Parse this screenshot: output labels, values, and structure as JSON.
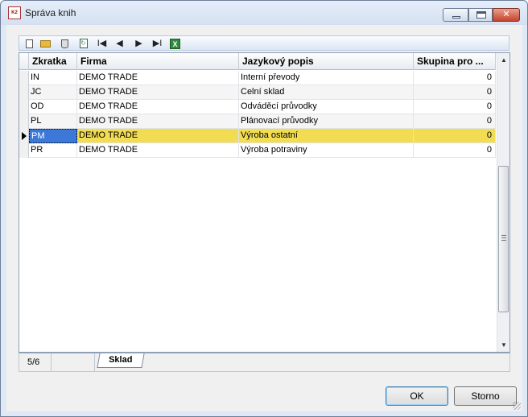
{
  "window": {
    "title": "Správa knih",
    "app_icon": "k2-app-icon",
    "controls": {
      "minimize": "minimize-icon",
      "maximize": "maximize-icon",
      "close": "close-icon"
    }
  },
  "toolbar": {
    "buttons": [
      {
        "icon": "new-document-icon",
        "glyph": ""
      },
      {
        "icon": "open-folder-icon",
        "glyph": ""
      },
      {
        "icon": "delete-icon",
        "glyph": ""
      },
      {
        "icon": "refresh-icon",
        "glyph": "↻"
      },
      {
        "icon": "first-record-icon",
        "glyph": "I◀"
      },
      {
        "icon": "previous-record-icon",
        "glyph": "◀"
      },
      {
        "icon": "next-record-icon",
        "glyph": "▶"
      },
      {
        "icon": "last-record-icon",
        "glyph": "▶I"
      },
      {
        "icon": "excel-export-icon",
        "glyph": "X"
      }
    ]
  },
  "grid": {
    "columns": [
      "Zkratka",
      "Firma",
      "Jazykový popis",
      "Skupina pro ..."
    ],
    "rows": [
      {
        "zkratka": "IN",
        "firma": "DEMO TRADE",
        "popis": "Interní převody",
        "skupina": "0"
      },
      {
        "zkratka": "JC",
        "firma": "DEMO TRADE",
        "popis": "Celní sklad",
        "skupina": "0"
      },
      {
        "zkratka": "OD",
        "firma": "DEMO TRADE",
        "popis": "Odváděcí průvodky",
        "skupina": "0"
      },
      {
        "zkratka": "PL",
        "firma": "DEMO TRADE",
        "popis": "Plánovací průvodky",
        "skupina": "0"
      },
      {
        "zkratka": "PM",
        "firma": "DEMO TRADE",
        "popis": "Výroba ostatní",
        "skupina": "0"
      },
      {
        "zkratka": "PR",
        "firma": "DEMO TRADE",
        "popis": "Výroba  potraviny",
        "skupina": "0"
      }
    ],
    "selected_index": 4,
    "colors": {
      "selected_row": "#f1dc52",
      "focused_cell": "#3c78d8"
    }
  },
  "status": {
    "record_position": "5/6",
    "tab_label": "Sklad"
  },
  "buttons": {
    "ok_label": "OK",
    "cancel_label": "Storno"
  }
}
